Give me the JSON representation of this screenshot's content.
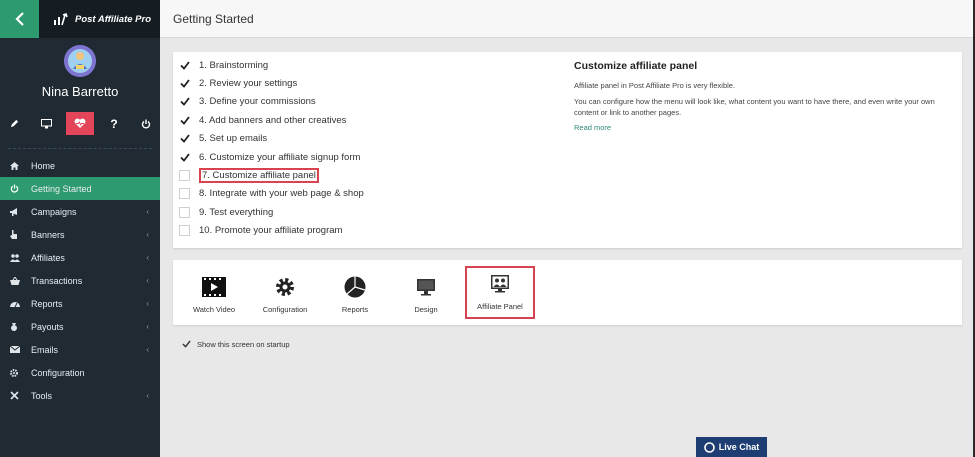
{
  "brand": {
    "name": "Post Affiliate Pro"
  },
  "user": {
    "name": "Nina Barretto"
  },
  "header": {
    "title": "Getting Started"
  },
  "sidebar": {
    "items": [
      {
        "label": "Home",
        "icon": "home-icon",
        "has_submenu": false
      },
      {
        "label": "Getting Started",
        "icon": "power-icon",
        "has_submenu": false,
        "active": true
      },
      {
        "label": "Campaigns",
        "icon": "megaphone-icon",
        "has_submenu": true
      },
      {
        "label": "Banners",
        "icon": "hand-pointer-icon",
        "has_submenu": true
      },
      {
        "label": "Affiliates",
        "icon": "users-icon",
        "has_submenu": true
      },
      {
        "label": "Transactions",
        "icon": "basket-icon",
        "has_submenu": true
      },
      {
        "label": "Reports",
        "icon": "speedometer-icon",
        "has_submenu": true
      },
      {
        "label": "Payouts",
        "icon": "money-bag-icon",
        "has_submenu": true
      },
      {
        "label": "Emails",
        "icon": "envelope-icon",
        "has_submenu": true
      },
      {
        "label": "Configuration",
        "icon": "gear-icon",
        "has_submenu": false
      },
      {
        "label": "Tools",
        "icon": "wrench-icon",
        "has_submenu": true
      }
    ]
  },
  "steps": [
    {
      "label": "1. Brainstorming",
      "checked": true
    },
    {
      "label": "2. Review your settings",
      "checked": true
    },
    {
      "label": "3. Define your commissions",
      "checked": true
    },
    {
      "label": "4. Add banners and other creatives",
      "checked": true
    },
    {
      "label": "5. Set up emails",
      "checked": true
    },
    {
      "label": "6. Customize your affiliate signup form",
      "checked": true
    },
    {
      "label": "7. Customize affiliate panel",
      "checked": false,
      "highlighted": true
    },
    {
      "label": "8. Integrate with your web page & shop",
      "checked": false
    },
    {
      "label": "9. Test everything",
      "checked": false
    },
    {
      "label": "10. Promote your affiliate program",
      "checked": false
    }
  ],
  "info": {
    "title": "Customize affiliate panel",
    "p1": "Affiliate panel in Post Affiliate Pro is very flexible.",
    "p2": "You can configure how the menu will look like, what content you want to have there, and even write your own content or link to another pages.",
    "link": "Read more"
  },
  "tiles": [
    {
      "label": "Watch Video",
      "icon": "video-icon"
    },
    {
      "label": "Configuration",
      "icon": "gear-icon"
    },
    {
      "label": "Reports",
      "icon": "pie-chart-icon"
    },
    {
      "label": "Design",
      "icon": "monitor-icon"
    },
    {
      "label": "Affiliate Panel",
      "icon": "affiliate-panel-icon",
      "highlighted": true
    }
  ],
  "startup": {
    "label": "Show this screen on startup",
    "checked": true
  },
  "livechat": {
    "label": "Live Chat"
  },
  "colors": {
    "accent_green": "#2e9a6f",
    "sidebar_bg": "#1f2a33",
    "highlight_red": "#d9434f",
    "heart_red": "#e5455a",
    "livechat_blue": "#1e3d73"
  }
}
